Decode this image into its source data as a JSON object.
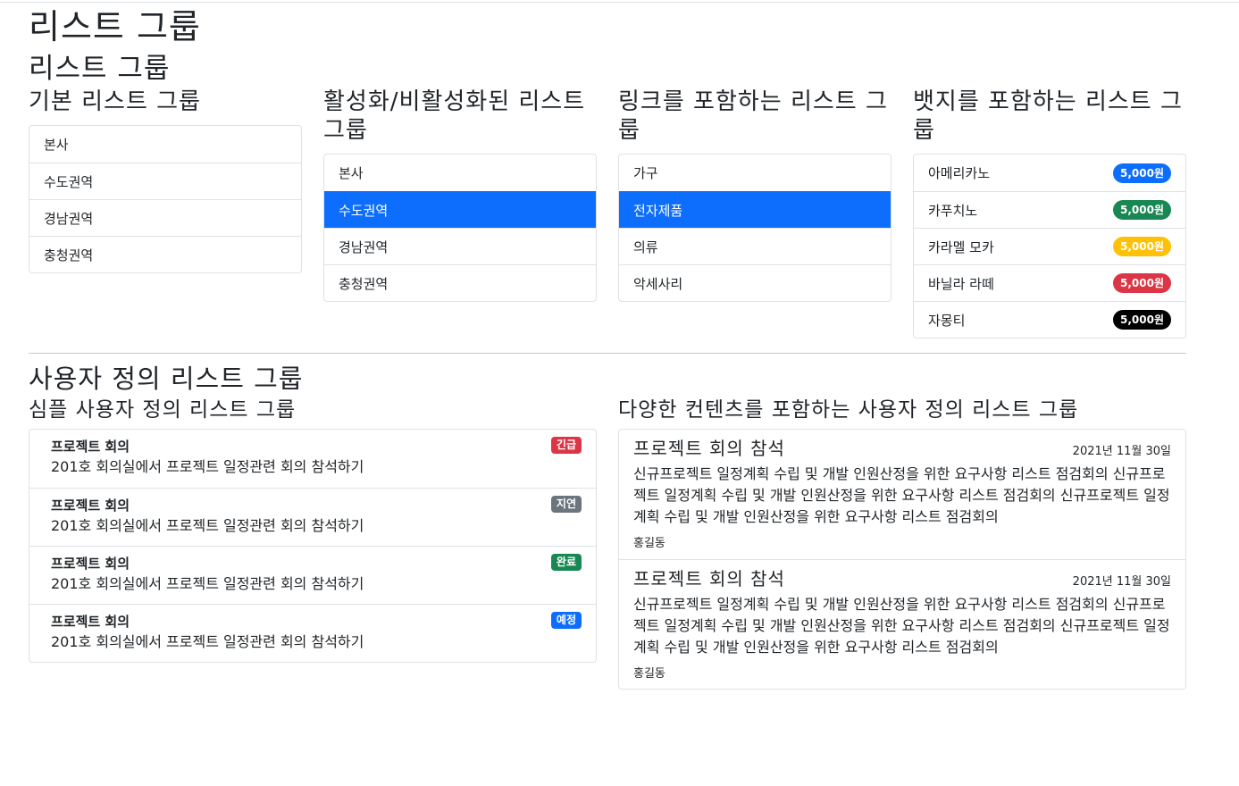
{
  "page": {
    "title": "리스트 그룹",
    "section_title": "리스트 그룹"
  },
  "basic": {
    "title": "기본 리스트 그룹",
    "items": [
      "본사",
      "수도권역",
      "경남권역",
      "충청권역"
    ]
  },
  "active": {
    "title": "활성화/비활성화된 리스트 그룹",
    "items": [
      "본사",
      "수도권역",
      "경남권역",
      "충청권역"
    ],
    "active_index": 1
  },
  "links": {
    "title": "링크를 포함하는 리스트 그룹",
    "items": [
      "가구",
      "전자제품",
      "의류",
      "악세사리"
    ],
    "active_index": 1
  },
  "badges": {
    "title": "뱃지를 포함하는 리스트 그룹",
    "items": [
      {
        "label": "아메리카노",
        "badge": "5,000원",
        "color": "#0d6efd"
      },
      {
        "label": "카푸치노",
        "badge": "5,000원",
        "color": "#198754"
      },
      {
        "label": "카라멜 모카",
        "badge": "5,000원",
        "color": "#ffc107"
      },
      {
        "label": "바닐라 라떼",
        "badge": "5,000원",
        "color": "#dc3545"
      },
      {
        "label": "자몽티",
        "badge": "5,000원",
        "color": "#000000"
      }
    ]
  },
  "custom": {
    "section_title": "사용자 정의 리스트 그룹",
    "simple": {
      "title": "심플 사용자 정의 리스트 그룹",
      "items": [
        {
          "heading": "프로젝트 회의",
          "body": "201호 회의실에서 프로젝트 일정관련 회의 참석하기",
          "badge": "긴급",
          "color": "#dc3545"
        },
        {
          "heading": "프로젝트 회의",
          "body": "201호 회의실에서 프로젝트 일정관련 회의 참석하기",
          "badge": "지연",
          "color": "#6c757d"
        },
        {
          "heading": "프로젝트 회의",
          "body": "201호 회의실에서 프로젝트 일정관련 회의 참석하기",
          "badge": "완료",
          "color": "#198754"
        },
        {
          "heading": "프로젝트 회의",
          "body": "201호 회의실에서 프로젝트 일정관련 회의 참석하기",
          "badge": "예정",
          "color": "#0d6efd"
        }
      ]
    },
    "rich": {
      "title": "다양한 컨텐츠를 포함하는 사용자 정의 리스트 그룹",
      "items": [
        {
          "heading": "프로젝트 회의 참석",
          "date": "2021년 11월 30일",
          "body": "신규프로젝트 일정계획 수립 및 개발 인원산정을 위한 요구사항 리스트 점검회의 신규프로젝트 일정계획 수립 및 개발 인원산정을 위한 요구사항 리스트 점검회의 신규프로젝트 일정계획 수립 및 개발 인원산정을 위한 요구사항 리스트 점검회의",
          "author": "홍길동"
        },
        {
          "heading": "프로젝트 회의 참석",
          "date": "2021년 11월 30일",
          "body": "신규프로젝트 일정계획 수립 및 개발 인원산정을 위한 요구사항 리스트 점검회의 신규프로젝트 일정계획 수립 및 개발 인원산정을 위한 요구사항 리스트 점검회의 신규프로젝트 일정계획 수립 및 개발 인원산정을 위한 요구사항 리스트 점검회의",
          "author": "홍길동"
        }
      ]
    }
  }
}
